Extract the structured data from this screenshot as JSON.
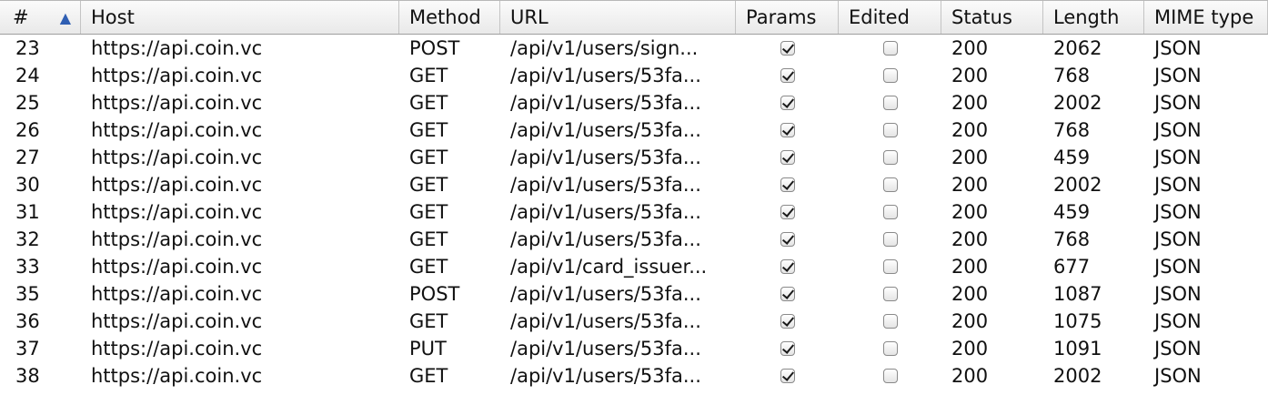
{
  "columns": [
    "#",
    "Host",
    "Method",
    "URL",
    "Params",
    "Edited",
    "Status",
    "Length",
    "MIME type"
  ],
  "sort_indicator": "sort-ascending-icon",
  "rows": [
    {
      "id": "23",
      "host": "https://api.coin.vc",
      "method": "POST",
      "url": "/api/v1/users/sign...",
      "params": true,
      "edited": false,
      "status": "200",
      "length": "2062",
      "mime": "JSON"
    },
    {
      "id": "24",
      "host": "https://api.coin.vc",
      "method": "GET",
      "url": "/api/v1/users/53fa...",
      "params": true,
      "edited": false,
      "status": "200",
      "length": "768",
      "mime": "JSON"
    },
    {
      "id": "25",
      "host": "https://api.coin.vc",
      "method": "GET",
      "url": "/api/v1/users/53fa...",
      "params": true,
      "edited": false,
      "status": "200",
      "length": "2002",
      "mime": "JSON"
    },
    {
      "id": "26",
      "host": "https://api.coin.vc",
      "method": "GET",
      "url": "/api/v1/users/53fa...",
      "params": true,
      "edited": false,
      "status": "200",
      "length": "768",
      "mime": "JSON"
    },
    {
      "id": "27",
      "host": "https://api.coin.vc",
      "method": "GET",
      "url": "/api/v1/users/53fa...",
      "params": true,
      "edited": false,
      "status": "200",
      "length": "459",
      "mime": "JSON"
    },
    {
      "id": "30",
      "host": "https://api.coin.vc",
      "method": "GET",
      "url": "/api/v1/users/53fa...",
      "params": true,
      "edited": false,
      "status": "200",
      "length": "2002",
      "mime": "JSON"
    },
    {
      "id": "31",
      "host": "https://api.coin.vc",
      "method": "GET",
      "url": "/api/v1/users/53fa...",
      "params": true,
      "edited": false,
      "status": "200",
      "length": "459",
      "mime": "JSON"
    },
    {
      "id": "32",
      "host": "https://api.coin.vc",
      "method": "GET",
      "url": "/api/v1/users/53fa...",
      "params": true,
      "edited": false,
      "status": "200",
      "length": "768",
      "mime": "JSON"
    },
    {
      "id": "33",
      "host": "https://api.coin.vc",
      "method": "GET",
      "url": "/api/v1/card_issuer...",
      "params": true,
      "edited": false,
      "status": "200",
      "length": "677",
      "mime": "JSON"
    },
    {
      "id": "35",
      "host": "https://api.coin.vc",
      "method": "POST",
      "url": "/api/v1/users/53fa...",
      "params": true,
      "edited": false,
      "status": "200",
      "length": "1087",
      "mime": "JSON"
    },
    {
      "id": "36",
      "host": "https://api.coin.vc",
      "method": "GET",
      "url": "/api/v1/users/53fa...",
      "params": true,
      "edited": false,
      "status": "200",
      "length": "1075",
      "mime": "JSON"
    },
    {
      "id": "37",
      "host": "https://api.coin.vc",
      "method": "PUT",
      "url": "/api/v1/users/53fa...",
      "params": true,
      "edited": false,
      "status": "200",
      "length": "1091",
      "mime": "JSON"
    },
    {
      "id": "38",
      "host": "https://api.coin.vc",
      "method": "GET",
      "url": "/api/v1/users/53fa...",
      "params": true,
      "edited": false,
      "status": "200",
      "length": "2002",
      "mime": "JSON"
    }
  ]
}
